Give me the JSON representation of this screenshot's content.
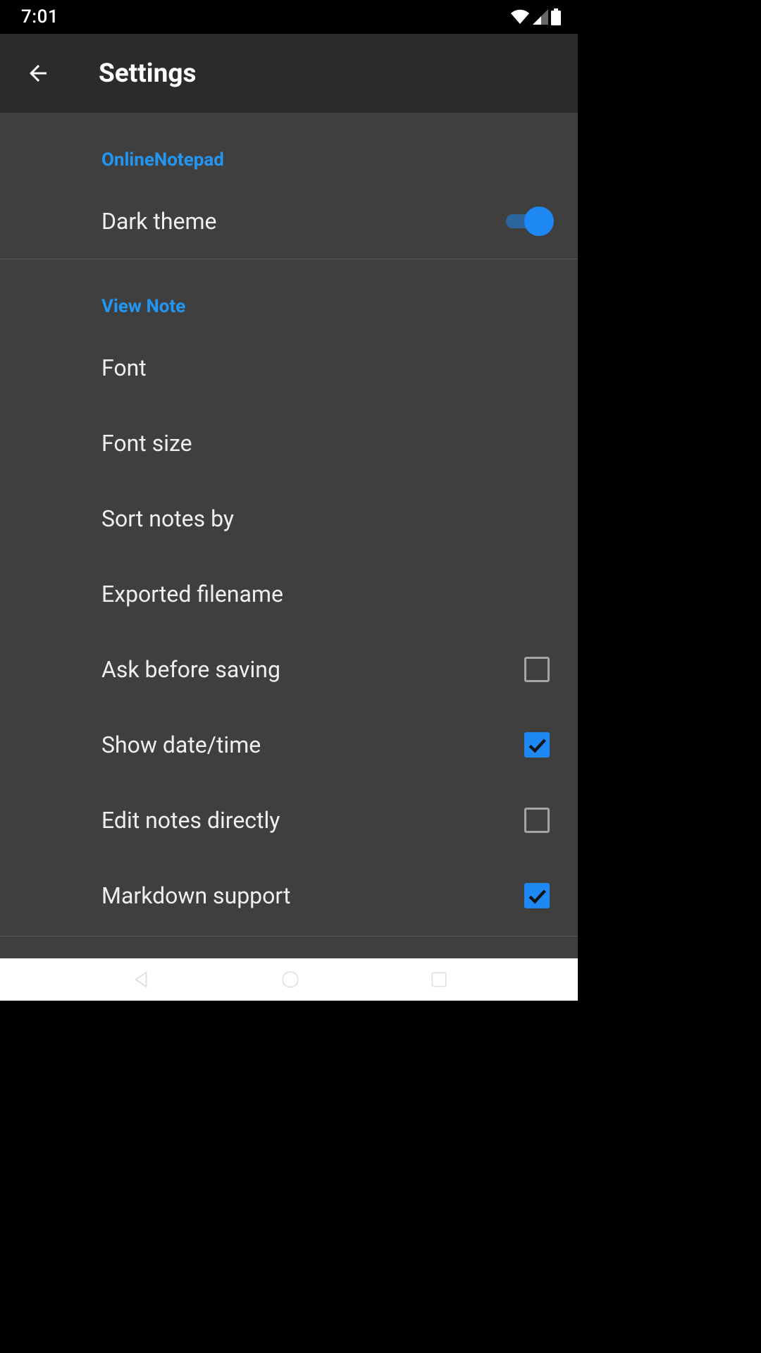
{
  "status": {
    "time": "7:01"
  },
  "header": {
    "title": "Settings"
  },
  "sections": {
    "s0": {
      "title": "OnlineNotepad"
    },
    "s1": {
      "title": "View Note"
    }
  },
  "rows": {
    "dark_theme": {
      "label": "Dark theme",
      "toggle_on": true
    },
    "font": {
      "label": "Font"
    },
    "font_size": {
      "label": "Font size"
    },
    "sort_notes_by": {
      "label": "Sort notes by"
    },
    "exported_filename": {
      "label": "Exported filename"
    },
    "ask_before_saving": {
      "label": "Ask before saving",
      "checked": false
    },
    "show_date_time": {
      "label": "Show date/time",
      "checked": true
    },
    "edit_directly": {
      "label": "Edit notes directly",
      "checked": false
    },
    "markdown": {
      "label": "Markdown support",
      "checked": true
    }
  }
}
